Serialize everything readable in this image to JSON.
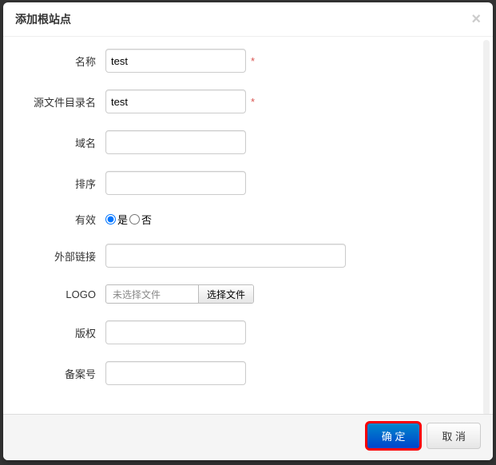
{
  "header": {
    "title": "添加根站点"
  },
  "form": {
    "name": {
      "label": "名称",
      "value": "test",
      "required": "*"
    },
    "srcDir": {
      "label": "源文件目录名",
      "value": "test",
      "required": "*"
    },
    "domain": {
      "label": "域名",
      "value": ""
    },
    "order": {
      "label": "排序",
      "value": ""
    },
    "valid": {
      "label": "有效",
      "yes": "是",
      "no": "否"
    },
    "extLink": {
      "label": "外部链接",
      "value": ""
    },
    "logo": {
      "label": "LOGO",
      "status": "未选择文件",
      "button": "选择文件"
    },
    "copyright": {
      "label": "版权",
      "value": ""
    },
    "record": {
      "label": "备案号",
      "value": ""
    }
  },
  "footer": {
    "ok": "确 定",
    "cancel": "取 消"
  }
}
